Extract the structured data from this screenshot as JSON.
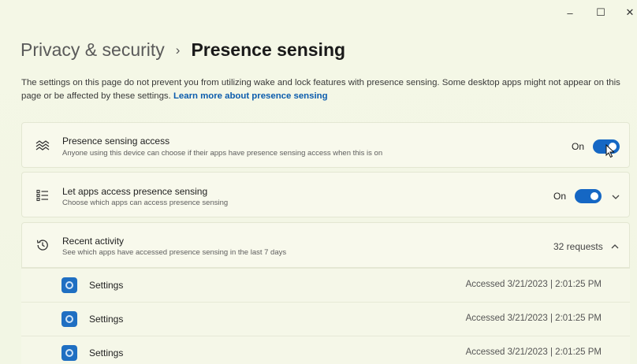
{
  "window": {
    "minimize_glyph": "–",
    "maximize_glyph": "☐",
    "close_glyph": "✕"
  },
  "header": {
    "parent": "Privacy & security",
    "separator": "›",
    "current": "Presence sensing"
  },
  "description": {
    "text": "The settings on this page do not prevent you from utilizing wake and lock features with presence sensing. Some desktop apps might not appear on this page or be affected by these settings.",
    "link": "Learn more about presence sensing"
  },
  "cards": {
    "access": {
      "icon": "presence-sensing-icon",
      "title": "Presence sensing access",
      "subtitle": "Anyone using this device can choose if their apps have presence sensing access when this is on",
      "toggle_label": "On",
      "toggle_on": true
    },
    "apps": {
      "icon": "app-list-icon",
      "title": "Let apps access presence sensing",
      "subtitle": "Choose which apps can access presence sensing",
      "toggle_label": "On",
      "toggle_on": true
    },
    "recent": {
      "icon": "history-icon",
      "title": "Recent activity",
      "subtitle": "See which apps have accessed presence sensing in the last 7 days",
      "count": "32 requests"
    }
  },
  "recent_items": [
    {
      "name": "Settings",
      "accessed": "Accessed 3/21/2023  |  2:01:25 PM"
    },
    {
      "name": "Settings",
      "accessed": "Accessed 3/21/2023  |  2:01:25 PM"
    },
    {
      "name": "Settings",
      "accessed": "Accessed 3/21/2023  |  2:01:25 PM"
    }
  ],
  "colors": {
    "accent": "#1567c4",
    "link": "#0b5cad",
    "background": "#f3f6e5"
  }
}
